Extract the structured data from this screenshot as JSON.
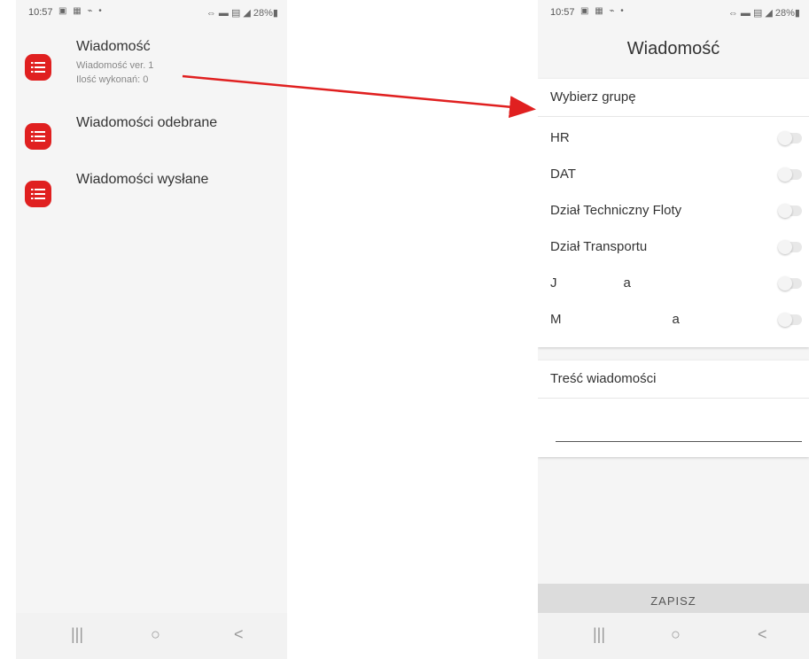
{
  "left": {
    "status": {
      "time": "10:57",
      "icons": "▣ ▦ ⌁ •",
      "right": "⇔ ▬ ▤ ◢ 28%▮"
    },
    "items": [
      {
        "title": "Wiadomość",
        "sub1": "Wiadomość ver. 1",
        "sub2": "Ilość wykonań: 0"
      },
      {
        "title": "Wiadomości odebrane"
      },
      {
        "title": "Wiadomości wysłane"
      }
    ]
  },
  "right": {
    "status": {
      "time": "10:57",
      "icons": "▣ ▦ ⌁ •",
      "right": "⇔ ▬ ▤ ◢ 28%▮"
    },
    "title": "Wiadomość",
    "groups_header": "Wybierz grupę",
    "groups": [
      {
        "name": "HR",
        "on": false
      },
      {
        "name": "DAT",
        "on": false
      },
      {
        "name": "Dział Techniczny Floty",
        "on": false
      },
      {
        "name": "Dział Transportu",
        "on": false
      },
      {
        "name": "J                  a",
        "on": false
      },
      {
        "name": "M                              a",
        "on": false
      }
    ],
    "message_header": "Treść wiadomości",
    "message_value": "",
    "save_label": "ZAPISZ"
  },
  "nav": {
    "recent": "|||",
    "home": "○",
    "back": "<"
  },
  "colors": {
    "accent": "#e02020",
    "arrow": "#e02020",
    "toggle_off": "#e8e8e8"
  }
}
